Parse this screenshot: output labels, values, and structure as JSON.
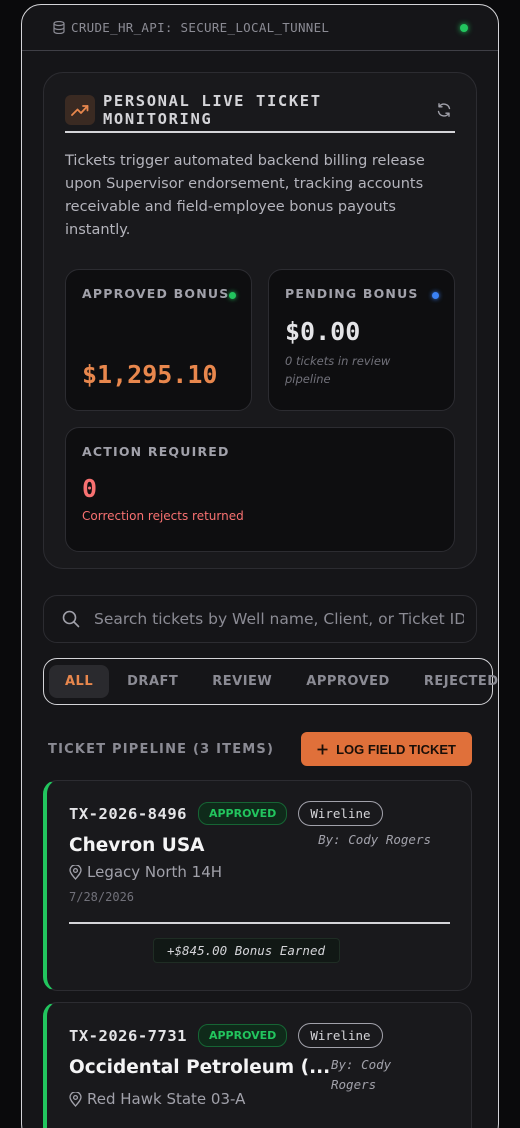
{
  "topbar": {
    "title": "CRUDE_HR_API: SECURE_LOCAL_TUNNEL"
  },
  "panel": {
    "title": "PERSONAL LIVE TICKET MONITORING",
    "description": "Tickets trigger automated backend billing release upon Supervisor endorsement, tracking accounts receivable and field-employee bonus payouts instantly."
  },
  "stats": {
    "approved": {
      "label": "APPROVED BONUS",
      "value": "$1,295.10"
    },
    "pending": {
      "label": "PENDING BONUS",
      "value": "$0.00",
      "sub": "0 tickets in review pipeline"
    },
    "action": {
      "label": "ACTION REQUIRED",
      "value": "0",
      "sub": "Correction rejects returned"
    }
  },
  "search": {
    "placeholder": "Search tickets by Well name, Client, or Ticket ID"
  },
  "tabs": [
    "ALL",
    "DRAFT",
    "REVIEW",
    "APPROVED",
    "REJECTED"
  ],
  "pipeline": {
    "label": "TICKET PIPELINE (3 ITEMS)",
    "button_label": "LOG FIELD TICKET"
  },
  "tickets": [
    {
      "id": "TX-2026-8496",
      "status": "APPROVED",
      "type": "Wireline",
      "client": "Chevron USA",
      "by": "By: Cody Rogers",
      "location": "Legacy North 14H",
      "date": "7/28/2026",
      "bonus": "+$845.00 Bonus Earned"
    },
    {
      "id": "TX-2026-7731",
      "status": "APPROVED",
      "type": "Wireline",
      "client": "Occidental Petroleum (...",
      "by": "By: Cody Rogers",
      "location": "Red Hawk State 03-A"
    }
  ],
  "colors": {
    "accent": "#e0703a",
    "approved": "#22c55e",
    "pending": "#3b82f6",
    "danger": "#f87171"
  }
}
